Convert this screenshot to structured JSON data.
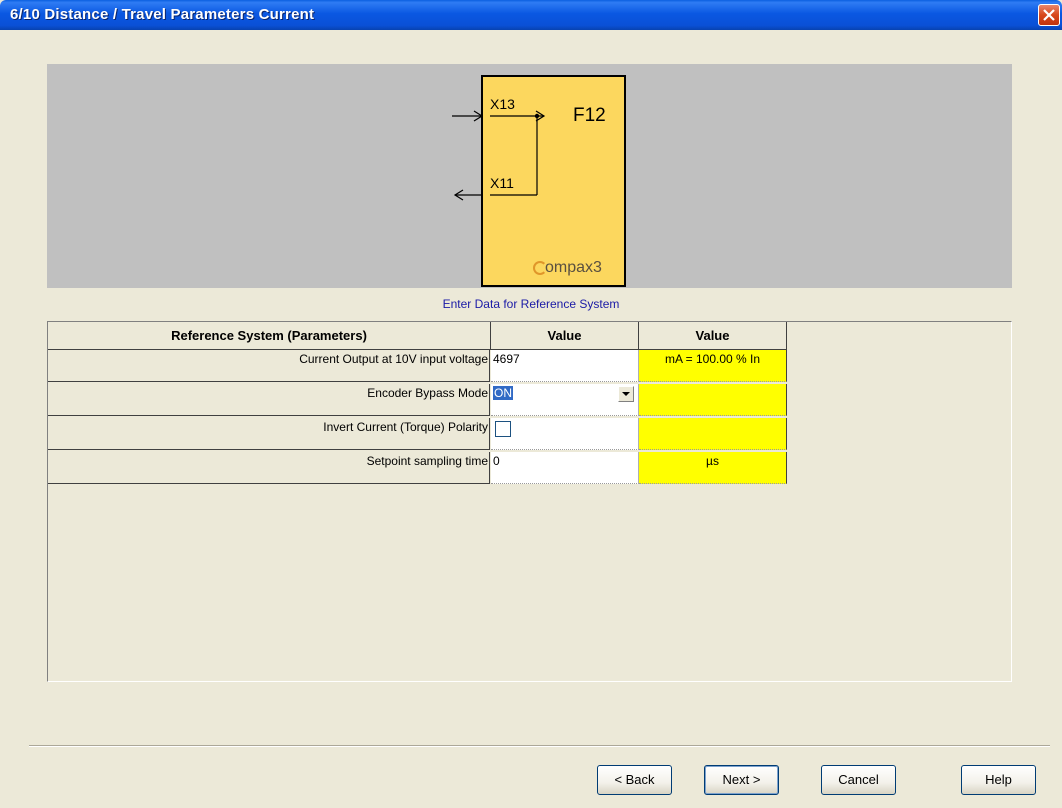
{
  "window": {
    "title": "6/10 Distance / Travel Parameters Current"
  },
  "diagram": {
    "port_top": "X13",
    "port_bottom": "X11",
    "output_label": "F12",
    "brand": "ompax3"
  },
  "caption": "Enter Data for Reference System",
  "grid": {
    "headers": [
      "Reference System (Parameters)",
      "Value",
      "Value"
    ],
    "rows": [
      {
        "label": "Current Output at 10V input voltage",
        "value": "4697",
        "unit": "mA = 100.00 % In"
      },
      {
        "label": "Encoder Bypass Mode",
        "value": "ON",
        "unit": ""
      },
      {
        "label": "Invert Current (Torque) Polarity",
        "value": "",
        "unit": ""
      },
      {
        "label": "Setpoint sampling time",
        "value": "0",
        "unit": "µs"
      }
    ]
  },
  "buttons": {
    "back": "< Back",
    "next": "Next >",
    "cancel": "Cancel",
    "help": "Help"
  },
  "colors": {
    "titlebar": "#0a58e2",
    "device": "#fcd75e",
    "unit_cell": "#ffff00",
    "caption": "#1a1aa6"
  },
  "icons": [
    "close-icon",
    "chevron-down-icon",
    "checkbox-icon"
  ]
}
